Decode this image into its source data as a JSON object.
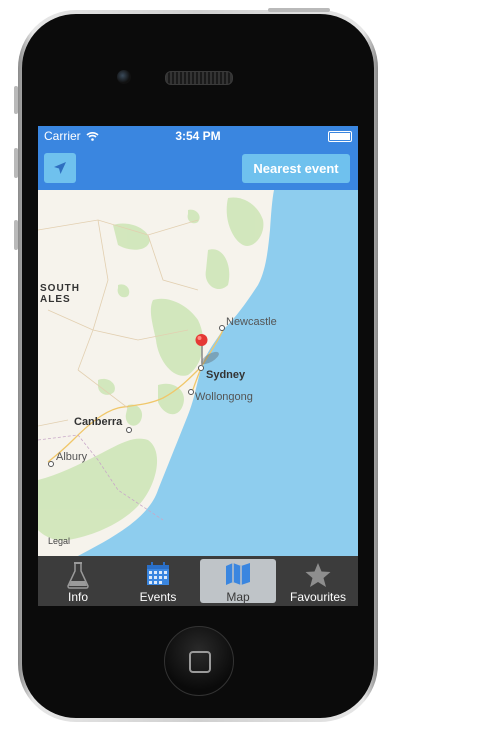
{
  "status_bar": {
    "carrier": "Carrier",
    "time": "3:54 PM"
  },
  "nav_bar": {
    "nearest_label": "Nearest event"
  },
  "map": {
    "labels": {
      "south": "SOUTH",
      "wales": "ALES",
      "newcastle": "Newcastle",
      "sydney": "Sydney",
      "wollongong": "Wollongong",
      "canberra": "Canberra",
      "albury": "Albury"
    },
    "legal": "Legal",
    "pin_color": "#e53935"
  },
  "tab_bar": {
    "tabs": [
      {
        "label": "Info",
        "icon": "flask-icon"
      },
      {
        "label": "Events",
        "icon": "calendar-icon"
      },
      {
        "label": "Map",
        "icon": "map-icon",
        "selected": true
      },
      {
        "label": "Favourites",
        "icon": "star-icon"
      }
    ]
  },
  "colors": {
    "accent": "#3a86e0",
    "button": "#6fc1ee",
    "tab_bar": "#3c3c3c",
    "sea": "#8ecdee"
  }
}
